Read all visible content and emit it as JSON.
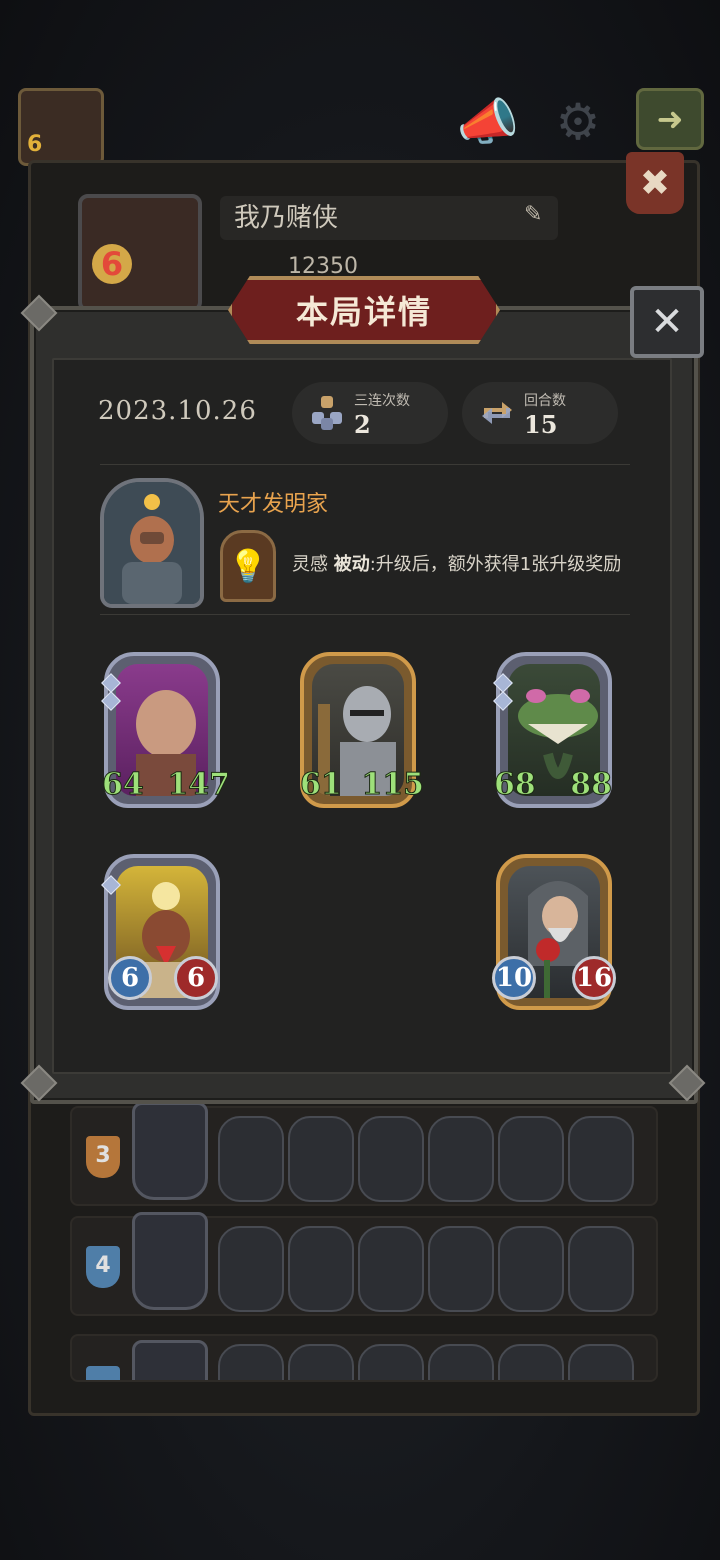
{
  "profile": {
    "name": "我乃赌侠",
    "score": "12350",
    "avatar_level": "6",
    "top_avatar_level": "6"
  },
  "modal": {
    "title": "本局详情",
    "date": "2023.10.26",
    "stats": [
      {
        "label": "三连次数",
        "value": "2",
        "icon": "triple-stack-icon"
      },
      {
        "label": "回合数",
        "value": "15",
        "icon": "cycle-arrows-icon"
      }
    ],
    "hero": {
      "name": "天才发明家",
      "skill_name": "灵感",
      "skill_type": "被动",
      "skill_desc": ":升级后，额外获得1张升级奖励"
    },
    "minions": [
      {
        "attack": "64",
        "health": "147",
        "frame": "purple",
        "style": "golden"
      },
      {
        "attack": "61",
        "health": "115",
        "frame": "gold",
        "style": "golden"
      },
      {
        "attack": "68",
        "health": "88",
        "frame": "blue",
        "style": "golden"
      },
      {
        "attack": "6",
        "health": "6",
        "frame": "blue",
        "style": "normal"
      },
      {
        "attack": "10",
        "health": "16",
        "frame": "gold",
        "style": "normal"
      }
    ]
  },
  "lineups": [
    {
      "rank": "3",
      "rank_color": "#b5763a"
    },
    {
      "rank": "4",
      "rank_color": "#4f7ea8"
    },
    {
      "rank": "",
      "rank_color": "#4f7ea8"
    }
  ],
  "colors": {
    "accent_orange": "#e8a34e",
    "attack_green": "#9ee07a",
    "health_green": "#9ee07a",
    "attack_blue": "#3d6fa8",
    "health_red": "#9e2a2a",
    "title_banner": "#6e1f1e"
  }
}
